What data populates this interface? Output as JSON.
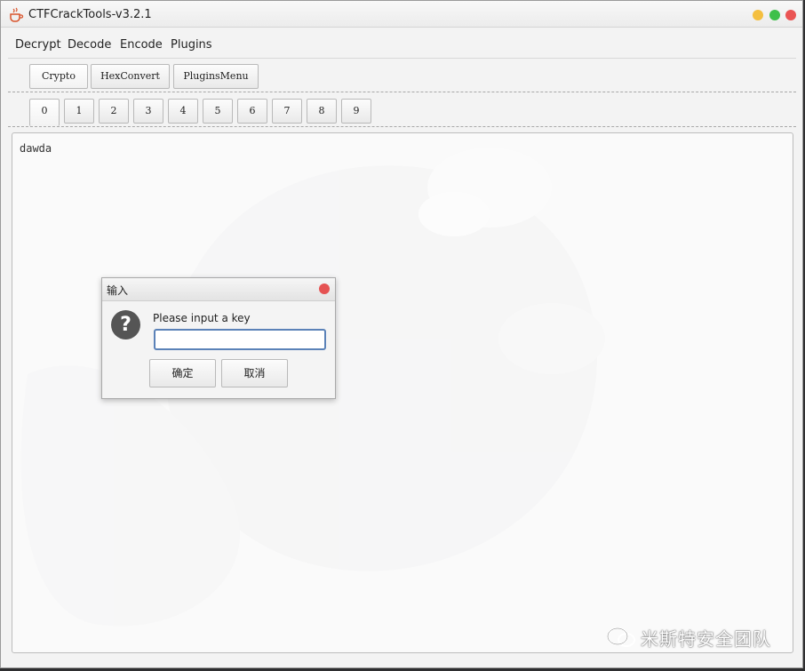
{
  "window": {
    "title": "CTFCrackTools-v3.2.1"
  },
  "menu": {
    "items": [
      "Decrypt",
      "Decode",
      "Encode",
      "Plugins"
    ]
  },
  "top_tabs": {
    "items": [
      "Crypto",
      "HexConvert",
      "PluginsMenu"
    ],
    "selected": "Crypto"
  },
  "num_tabs": {
    "items": [
      "0",
      "1",
      "2",
      "3",
      "4",
      "5",
      "6",
      "7",
      "8",
      "9"
    ],
    "selected": "0"
  },
  "content": {
    "text": "dawda"
  },
  "dialog": {
    "title": "输入",
    "question_mark": "?",
    "message": "Please input a key",
    "input_value": "",
    "ok_label": "确定",
    "cancel_label": "取消"
  },
  "watermark": {
    "text": "米斯特安全团队"
  },
  "colors": {
    "close": "#ea5453",
    "minimize": "#f4bf3f",
    "maximize": "#3ec04a",
    "input_focus": "#5b82b8"
  }
}
